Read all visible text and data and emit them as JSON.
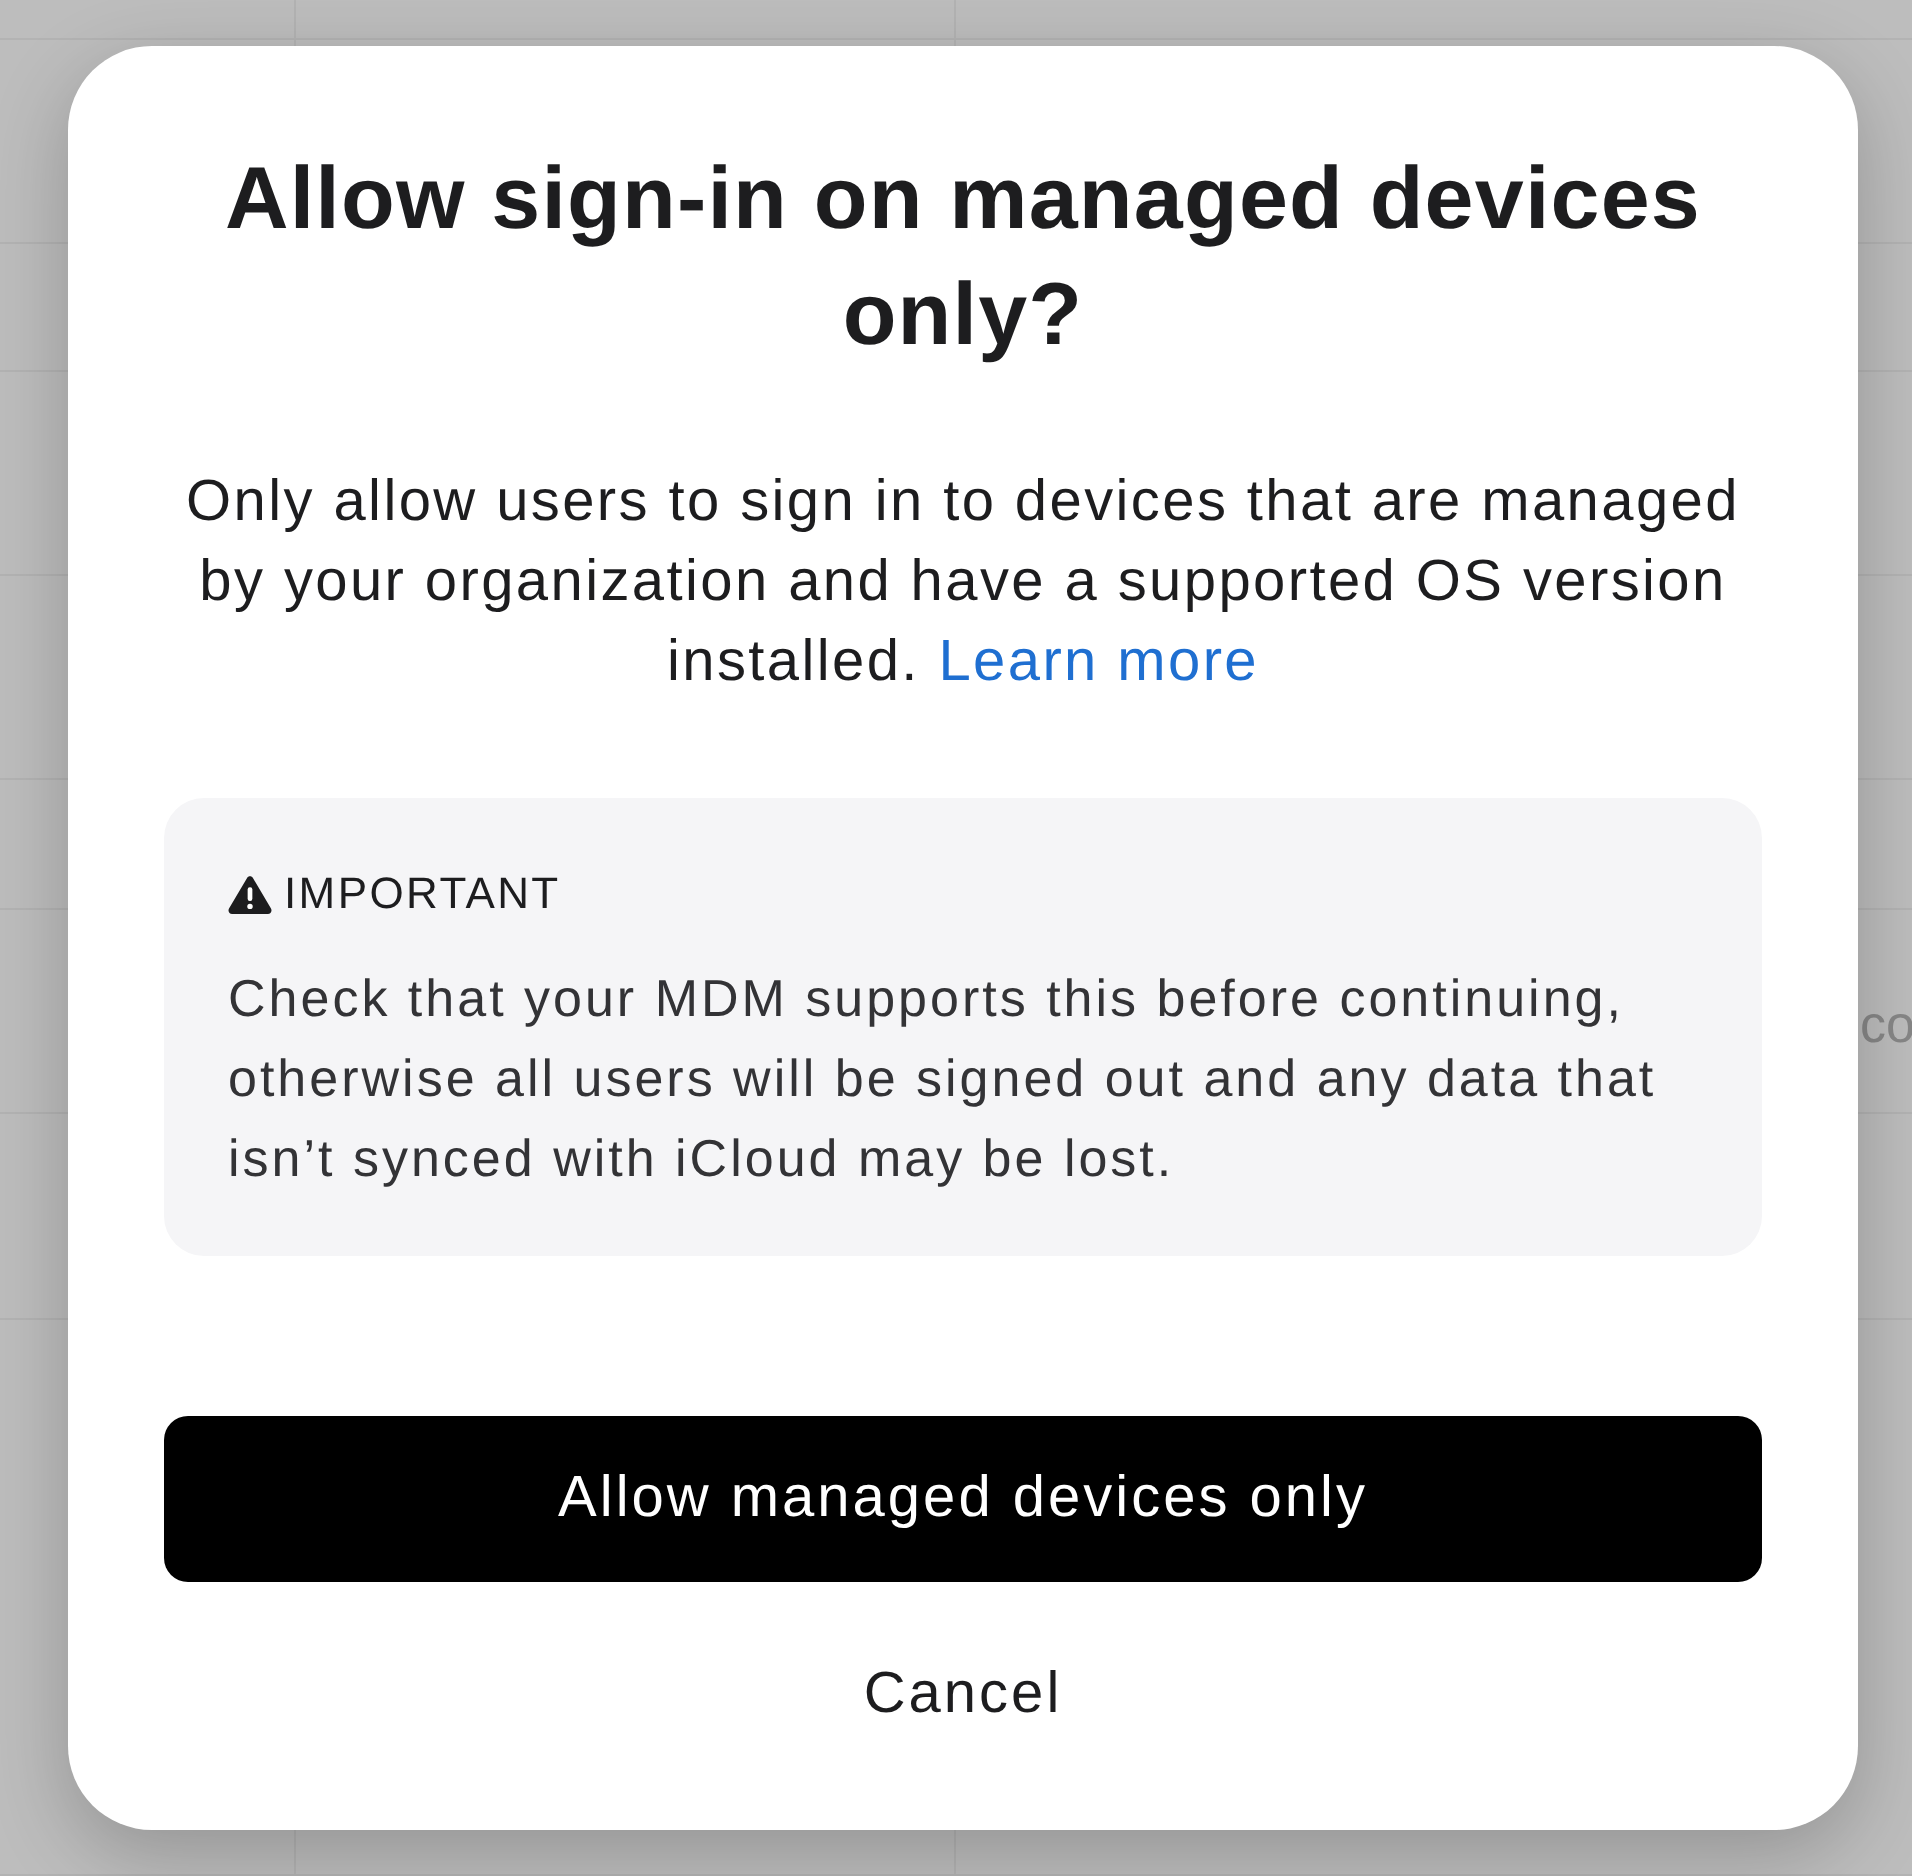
{
  "background": {
    "cell_text": "co"
  },
  "dialog": {
    "title": "Allow sign-in on managed devices only?",
    "message": "Only allow users to sign in to devices that are managed by your organization and have a supported OS version installed.",
    "link": "Learn more",
    "notice": {
      "heading": "IMPORTANT",
      "text": "Check that your MDM supports this before continuing, otherwise all users will be signed out and any data that isn’t synced with iCloud may be lost."
    },
    "buttons": [
      {
        "label": "Allow managed devices only",
        "kind": "primary"
      },
      {
        "label": "Cancel",
        "kind": "secondary"
      }
    ]
  }
}
